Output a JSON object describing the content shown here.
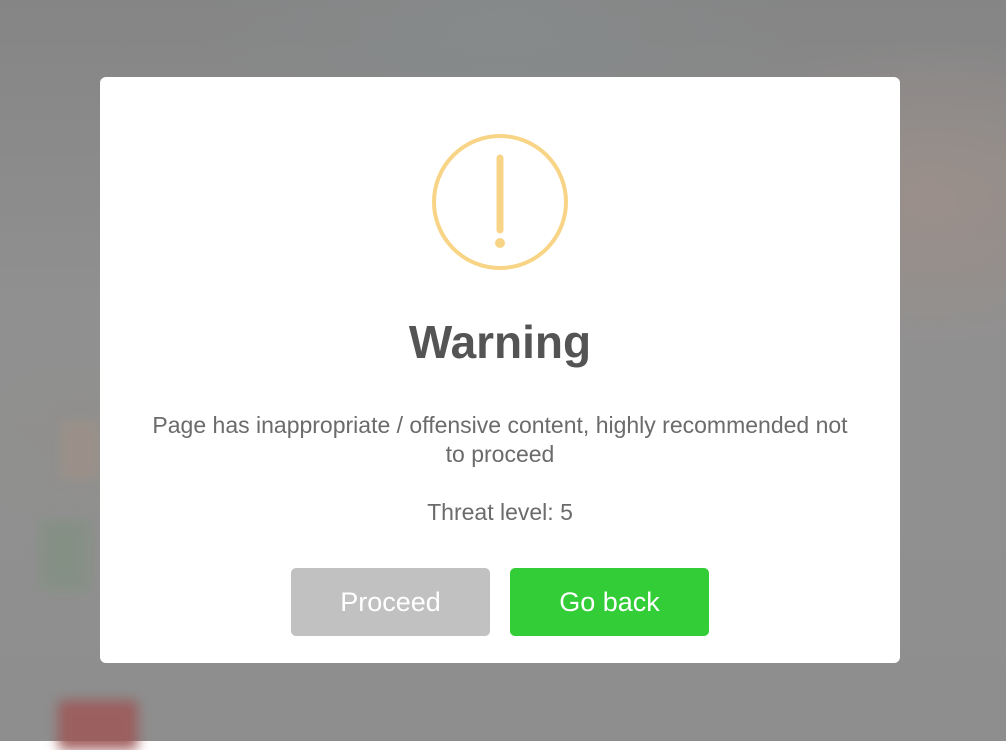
{
  "dialog": {
    "icon": "exclamation-circle-icon",
    "icon_color": "#f8d486",
    "title": "Warning",
    "message": "Page has inappropriate / offensive content, highly recommended not to proceed",
    "threat_label": "Threat level:",
    "threat_value": "5",
    "proceed_label": "Proceed",
    "go_back_label": "Go back"
  },
  "colors": {
    "proceed_button": "#c1c1c1",
    "go_back_button": "#33cd37",
    "title_text": "#545454",
    "body_text": "#6b6b6b"
  }
}
